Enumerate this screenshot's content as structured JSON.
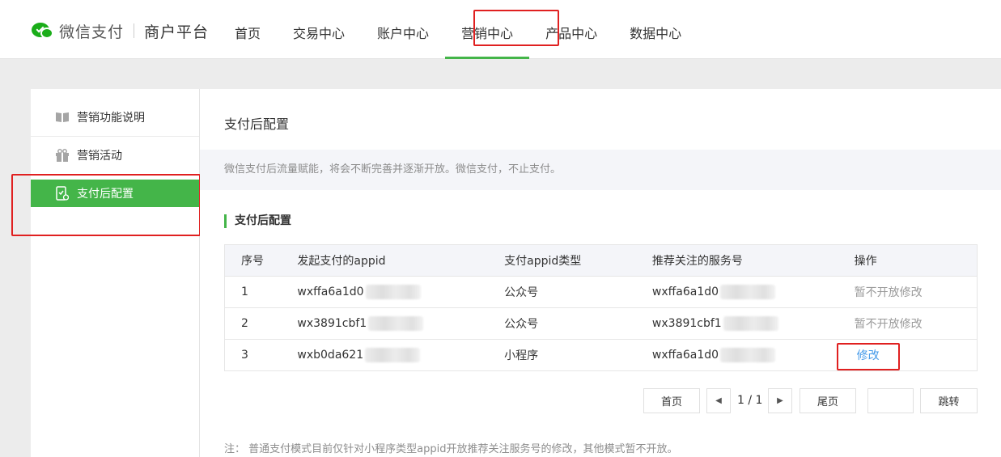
{
  "brand": {
    "name": "微信支付",
    "sub": "商户平台"
  },
  "nav": [
    "首页",
    "交易中心",
    "账户中心",
    "营销中心",
    "产品中心",
    "数据中心"
  ],
  "nav_active": "营销中心",
  "sidebar": [
    {
      "label": "营销功能说明",
      "icon": "book-icon"
    },
    {
      "label": "营销活动",
      "icon": "gift-icon"
    },
    {
      "label": "支付后配置",
      "icon": "phone-settings-icon"
    }
  ],
  "main": {
    "title": "支付后配置",
    "notice": "微信支付后流量赋能，将会不断完善并逐渐开放。微信支付，不止支付。",
    "section_title": "支付后配置",
    "table": {
      "headers": [
        "序号",
        "发起支付的appid",
        "支付appid类型",
        "推荐关注的服务号",
        "操作"
      ],
      "rows": [
        {
          "no": "1",
          "appid": "wxffa6a1d0",
          "type": "公众号",
          "service": "wxffa6a1d0",
          "op": "暂不开放修改",
          "op_link": false
        },
        {
          "no": "2",
          "appid": "wx3891cbf1",
          "type": "公众号",
          "service": "wx3891cbf1",
          "op": "暂不开放修改",
          "op_link": false
        },
        {
          "no": "3",
          "appid": "wxb0da621",
          "type": "小程序",
          "service": "wxffa6a1d0",
          "op": "修改",
          "op_link": true
        }
      ]
    },
    "pager": {
      "first": "首页",
      "current": "1 / 1",
      "last": "尾页",
      "jump": "跳转"
    },
    "note": "注： 普通支付模式目前仅针对小程序类型appid开放推荐关注服务号的修改，其他模式暂不开放。"
  },
  "colors": {
    "accent": "#44b549",
    "highlight": "#e02020",
    "link": "#459ae9"
  }
}
